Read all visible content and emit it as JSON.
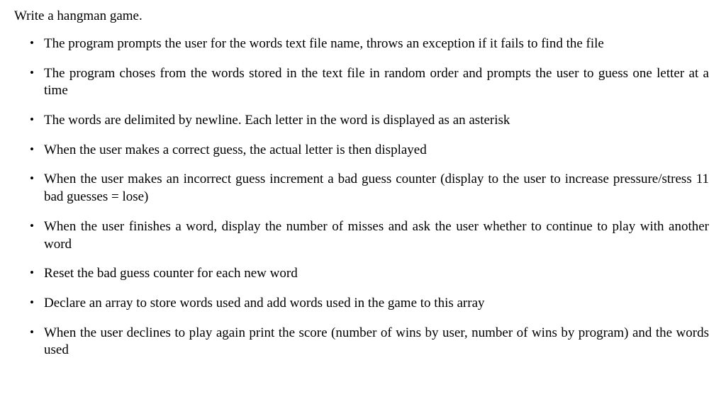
{
  "title": "Write a hangman game.",
  "bullets": [
    "The program prompts the user for the words text file name, throws an exception if it fails to find the file",
    "The program choses from the words stored in the text file in random order and prompts the user to guess one letter at a time",
    "The words are delimited by newline. Each letter in the word is displayed as an asterisk",
    "When the user makes a correct guess, the actual letter is then displayed",
    "When the user makes an incorrect guess increment a bad guess counter (display to the user to increase pressure/stress 11 bad guesses = lose)",
    "When the user finishes a word, display the number of misses and ask the user whether to continue to play with another word",
    "Reset the bad guess counter for each new word",
    "Declare an array to store words used and add words used in the game to this array",
    "When the user declines to play again print the score (number of wins by user, number of wins by program) and the words used"
  ]
}
